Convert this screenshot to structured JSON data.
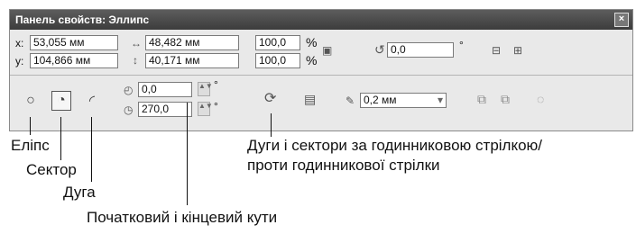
{
  "window": {
    "title": "Панель свойств: Эллипс",
    "close_glyph": "×"
  },
  "row1": {
    "x_label": "x:",
    "x_value": "53,055 мм",
    "y_label": "y:",
    "y_value": "104,866 мм",
    "width_value": "48,482 мм",
    "height_value": "40,171 мм",
    "scale_x": "100,0",
    "scale_y": "100,0",
    "percent": "%",
    "rotation_value": "0,0",
    "degree": "°"
  },
  "row2": {
    "start_angle": "0,0",
    "end_angle": "270,0",
    "degree": "°",
    "outline_width": "0,2 мм"
  },
  "captions": {
    "ellipse": "Еліпс",
    "sector": "Сектор",
    "arc": "Дуга",
    "angles": "Початковий і кінцевий кути",
    "direction_line1": "Дуги і сектори за годинниковою стрілкою/",
    "direction_line2": "проти годинникової стрілки"
  },
  "icons": [
    "width-icon",
    "height-icon",
    "lock-ratio-icon",
    "rotate-icon",
    "mirror-horizontal-icon",
    "mirror-vertical-icon",
    "ellipse-icon",
    "sector-icon",
    "arc-icon",
    "start-angle-icon",
    "end-angle-icon",
    "direction-toggle-icon",
    "wrap-text-icon",
    "outline-pen-icon",
    "to-front-icon",
    "to-back-icon",
    "convert-to-curves-icon"
  ]
}
